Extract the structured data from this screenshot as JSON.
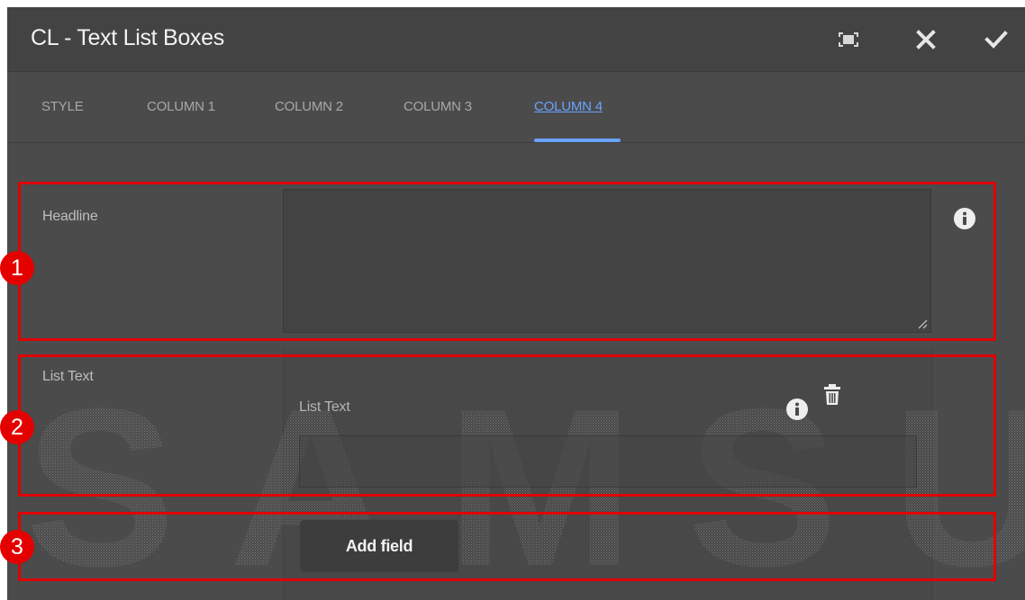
{
  "dialog": {
    "title": "CL - Text List Boxes",
    "buttons": {
      "fullscreen_icon": "fullscreen-icon",
      "close_icon": "close-icon",
      "done_icon": "check-icon"
    }
  },
  "tabs": [
    {
      "label": "STYLE",
      "active": false
    },
    {
      "label": "COLUMN 1",
      "active": false
    },
    {
      "label": "COLUMN 2",
      "active": false
    },
    {
      "label": "COLUMN 3",
      "active": false
    },
    {
      "label": "COLUMN 4",
      "active": true
    }
  ],
  "form": {
    "headline": {
      "label": "Headline",
      "value": ""
    },
    "list_text": {
      "label": "List Text",
      "item_label": "List Text",
      "item_value": ""
    },
    "add_field_label": "Add field"
  },
  "watermark": {
    "text": "SAMSUNG"
  },
  "callouts": [
    "1",
    "2",
    "3"
  ],
  "colors": {
    "background": "#4b4b4b",
    "titlebar": "#434343",
    "accent": "#6aa3ff",
    "callout": "#e00000"
  }
}
